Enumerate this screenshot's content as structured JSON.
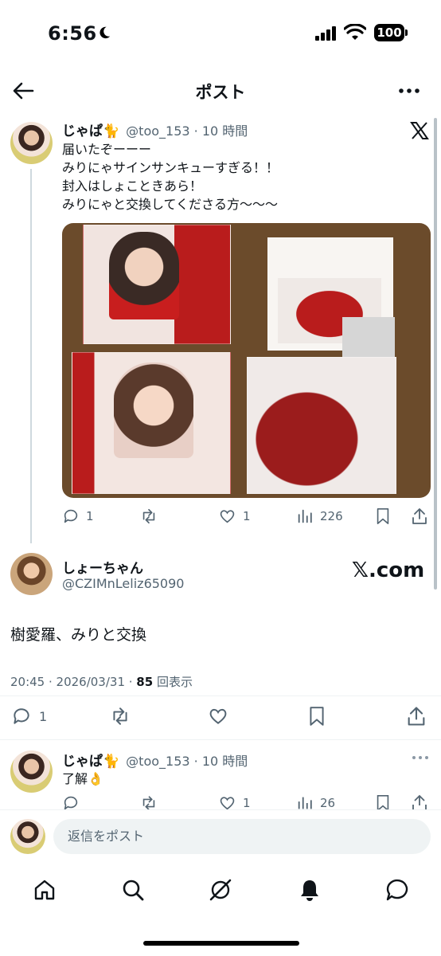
{
  "status": {
    "time": "6:56",
    "battery": "100"
  },
  "header": {
    "title": "ポスト"
  },
  "tweet1": {
    "name": "じゃぱ🐈",
    "handle": "@too_153 · 10 時間",
    "lines": [
      "届いたぞーーー",
      "みりにゃサインサンキューすぎる！！",
      "封入はしょこときあら！",
      "みりにゃと交換してくださる方〜〜〜"
    ],
    "actions": {
      "reply": "1",
      "repost": "",
      "like": "1",
      "views": "226"
    }
  },
  "tweet2": {
    "name": "しょーちゃん",
    "handle": "@CZIMnLeliz65090",
    "badge": "𝕏.com",
    "body": "樹愛羅、みりと交換",
    "meta_time": "20:45 · 2026/03/31 · ",
    "meta_count": "85",
    "meta_suffix": " 回表示",
    "actions": {
      "reply": "1"
    }
  },
  "tweet3": {
    "name": "じゃぱ🐈",
    "handle": "@too_153 · 10 時間",
    "body": "了解👌",
    "actions": {
      "reply": "",
      "repost": "",
      "like": "1",
      "views": "26"
    }
  },
  "reply": {
    "placeholder": "返信をポスト"
  },
  "icons": {
    "back": "arrow-left-icon",
    "more": "more-icon",
    "x": "x-logo-icon",
    "reply": "reply-icon",
    "repost": "repost-icon",
    "like": "heart-icon",
    "views": "views-icon",
    "bookmark": "bookmark-icon",
    "share": "share-icon"
  },
  "colors": {
    "text": "#0f1419",
    "secondary": "#536471",
    "divider": "#eff3f4"
  }
}
